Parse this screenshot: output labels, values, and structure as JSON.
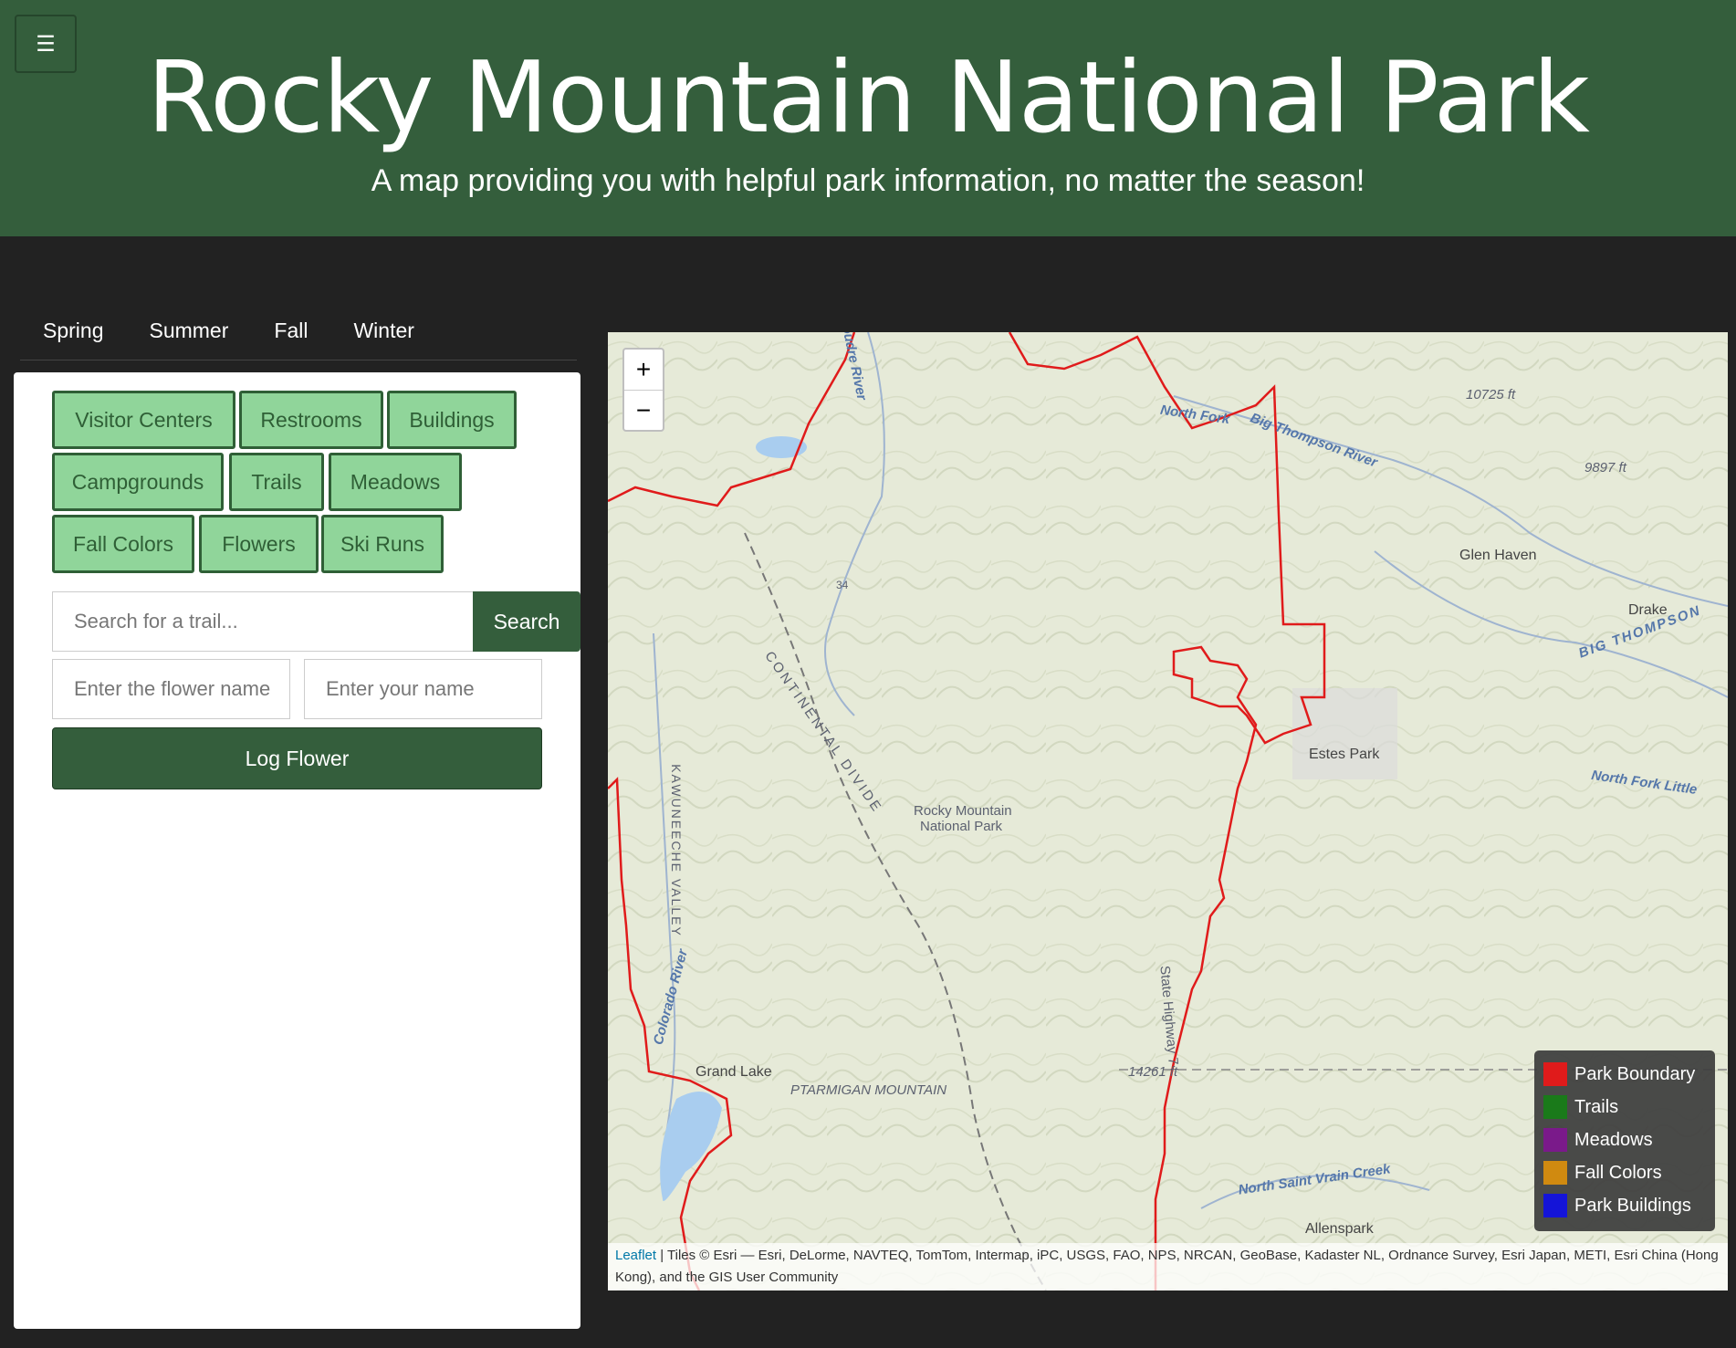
{
  "header": {
    "menu_icon": "☰",
    "title": "Rocky Mountain National Park",
    "subtitle": "A map providing you with helpful park information, no matter the season!"
  },
  "tabs": [
    "Spring",
    "Summer",
    "Fall",
    "Winter"
  ],
  "layers": {
    "visitor_centers": "Visitor Centers",
    "restrooms": "Restrooms",
    "buildings": "Buildings",
    "campgrounds": "Campgrounds",
    "trails": "Trails",
    "meadows": "Meadows",
    "fall_colors": "Fall Colors",
    "flowers": "Flowers",
    "ski_runs": "Ski Runs"
  },
  "search": {
    "placeholder": "Search for a trail...",
    "button": "Search"
  },
  "flower_log": {
    "flower_placeholder": "Enter the flower name",
    "name_placeholder": "Enter your name",
    "button": "Log Flower"
  },
  "map": {
    "zoom_in": "+",
    "zoom_out": "−",
    "labels": {
      "poudre": "Poudre River",
      "north_fork": "North Fork",
      "big_thompson": "Big Thompson River",
      "elev1": "10725 ft",
      "elev2": "9897 ft",
      "glen_haven": "Glen Haven",
      "drake": "Drake",
      "big_thompson2": "BIG THOMPSON",
      "estes_park": "Estes Park",
      "north_fork_little": "North Fork Little",
      "rmnp": "Rocky Mountain",
      "rmnp2": "National Park",
      "continental": "CONTINENTAL DIVIDE",
      "kawuneeche": "KAWUNEECHE VALLEY",
      "colorado_river": "Colorado River",
      "grand_lake": "Grand Lake",
      "ptarmigan": "PTARMIGAN MOUNTAIN",
      "elev3": "14261 ft",
      "highway": "State Highway 7",
      "saint_vrain": "North Saint Vrain Creek",
      "allenspark": "Allenspark",
      "hwy34": "34"
    }
  },
  "legend": [
    {
      "label": "Park Boundary",
      "color": "#e01b1b"
    },
    {
      "label": "Trails",
      "color": "#1a7a1a"
    },
    {
      "label": "Meadows",
      "color": "#7a1a8a"
    },
    {
      "label": "Fall Colors",
      "color": "#d08a10"
    },
    {
      "label": "Park Buildings",
      "color": "#1414d8"
    }
  ],
  "attribution": {
    "leaflet": "Leaflet",
    "text": " | Tiles © Esri — Esri, DeLorme, NAVTEQ, TomTom, Intermap, iPC, USGS, FAO, NPS, NRCAN, GeoBase, Kadaster NL, Ordnance Survey, Esri Japan, METI, Esri China (Hong Kong), and the GIS User Community"
  }
}
